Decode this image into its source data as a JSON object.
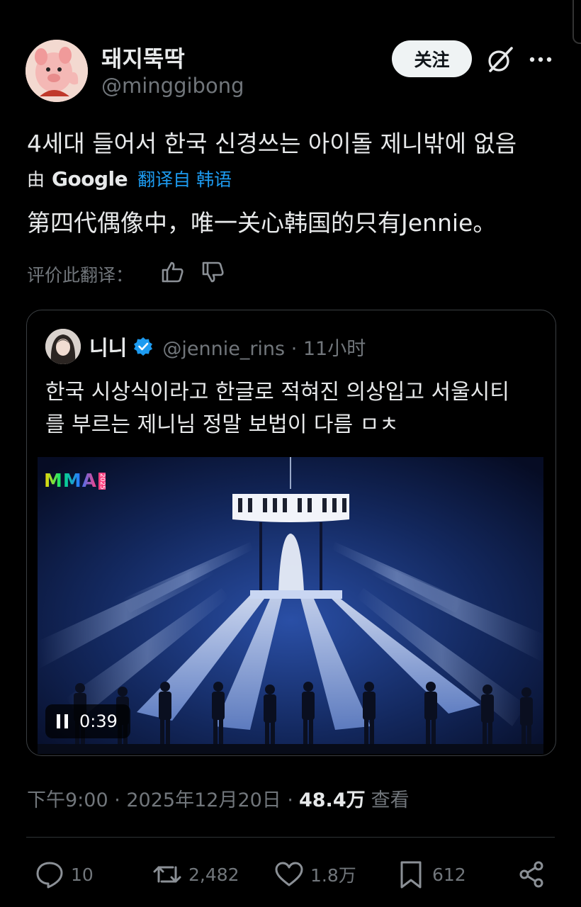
{
  "post": {
    "display_name": "돼지뚝딱",
    "handle": "@minggibong",
    "follow_label": "关注",
    "text": "4세대 들어서 한국 신경쓰는 아이돌 제니밖에 없음",
    "translation": {
      "by_label": "由",
      "provider": "Google",
      "link_label": "翻译自 韩语",
      "translated_text": "第四代偶像中，唯一关心韩国的只有Jennie。",
      "rate_label": "评价此翻译："
    },
    "timestamp": "下午9:00 · 2025年12月20日 ·",
    "views_count": "48.4万",
    "views_label": "查看"
  },
  "quote": {
    "name": "니니",
    "handle": "@jennie_rins · 11小时",
    "text_line1": "한국 시상식이라고 한글로 적혀진 의상입고 서울시티",
    "text_line2": "를 부르는 제니님 정말 보법이 다름 ㅁㅊ",
    "video": {
      "logo_text": "MMA",
      "logo_year": "2025",
      "time": "0:39"
    }
  },
  "actions": {
    "replies": "10",
    "reposts": "2,482",
    "likes": "1.8万",
    "bookmarks": "612"
  },
  "icons": [
    "grok-icon",
    "more-icon",
    "thumb-up-icon",
    "thumb-down-icon",
    "verified-icon",
    "pause-icon",
    "reply-icon",
    "repost-icon",
    "like-icon",
    "bookmark-icon",
    "share-icon"
  ],
  "colors": {
    "background": "#000000",
    "accent": "#1d9bf0",
    "muted": "#71767b",
    "text": "#e7e9ea"
  }
}
